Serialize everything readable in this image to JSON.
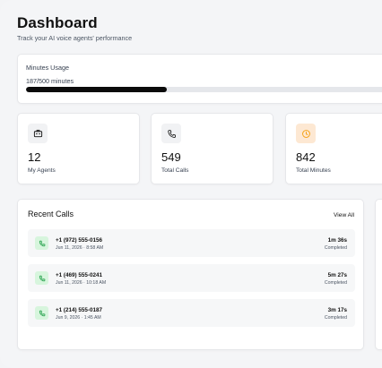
{
  "header": {
    "title": "Dashboard",
    "subtitle": "Track your AI voice agents' performance"
  },
  "usage": {
    "label": "Minutes Usage",
    "value_text": "187/500 minutes",
    "used": 187,
    "total": 500
  },
  "stats": [
    {
      "icon": "agents-icon",
      "number": "12",
      "label": "My Agents"
    },
    {
      "icon": "phone-icon",
      "number": "549",
      "label": "Total Calls"
    },
    {
      "icon": "clock-icon",
      "number": "842",
      "label": "Total Minutes"
    }
  ],
  "recent_calls": {
    "title": "Recent Calls",
    "view_all_label": "View All",
    "calls": [
      {
        "number": "+1 (972) 555-0156",
        "date": "Jun 11, 2026 · 8:58 AM",
        "duration": "1m 36s",
        "status": "Completed"
      },
      {
        "number": "+1 (469) 555-0241",
        "date": "Jun 11, 2026 · 10:18 AM",
        "duration": "5m 27s",
        "status": "Completed"
      },
      {
        "number": "+1 (214) 555-0187",
        "date": "Jun 9, 2026 · 1:45 AM",
        "duration": "3m 17s",
        "status": "Completed"
      }
    ]
  },
  "colors": {
    "accent_orange": "#f59e0b",
    "call_icon_green": "#22a04a",
    "progress_fill": "#0b0b0b"
  }
}
